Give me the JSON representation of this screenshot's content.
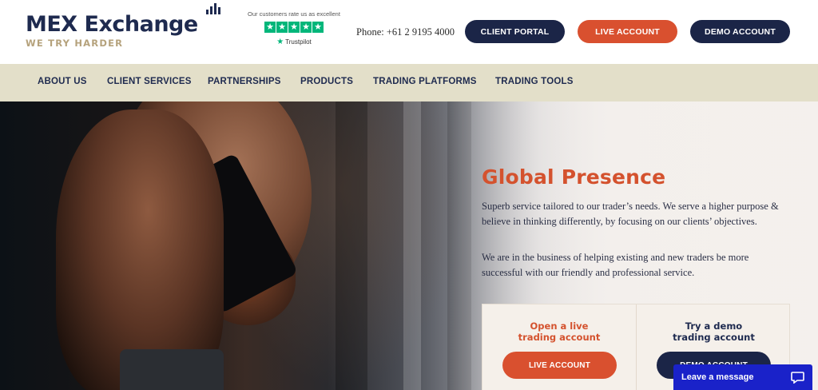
{
  "header": {
    "logo_name": "MEX Exchange",
    "logo_tagline": "WE TRY HARDER",
    "rating_text": "Our customers rate us as excellent",
    "trustpilot_label": "Trustpilot",
    "phone": "Phone: +61 2 9195 4000",
    "buttons": {
      "client_portal": "CLIENT PORTAL",
      "live_account": "LIVE ACCOUNT",
      "demo_account": "DEMO ACCOUNT"
    }
  },
  "nav": {
    "items": [
      "ABOUT US",
      "CLIENT SERVICES",
      "PARTNERSHIPS",
      "PRODUCTS",
      "TRADING PLATFORMS",
      "TRADING TOOLS"
    ]
  },
  "hero": {
    "title": "Global Presence",
    "paragraph1": "Superb service tailored to our trader’s needs. We serve a higher purpose & believe in thinking differently, by focusing on our clients’ objectives.",
    "paragraph2": "We are in the business of helping existing and new traders be more successful with our friendly and professional service.",
    "cards": {
      "live_title": "Open a live trading account",
      "live_button": "LIVE ACCOUNT",
      "demo_title": "Try a demo trading account",
      "demo_button": "DEMO ACCOUNT"
    }
  },
  "chat": {
    "label": "Leave a message"
  },
  "colors": {
    "navy": "#1b2547",
    "orange": "#d9502f",
    "nav_bg": "#e3dfc9",
    "trustpilot_green": "#00b67a",
    "chat_blue": "#1a22c9"
  },
  "icons": [
    "logo-bars-icon",
    "star-icon",
    "trustpilot-star-icon",
    "chat-bubble-icon"
  ]
}
